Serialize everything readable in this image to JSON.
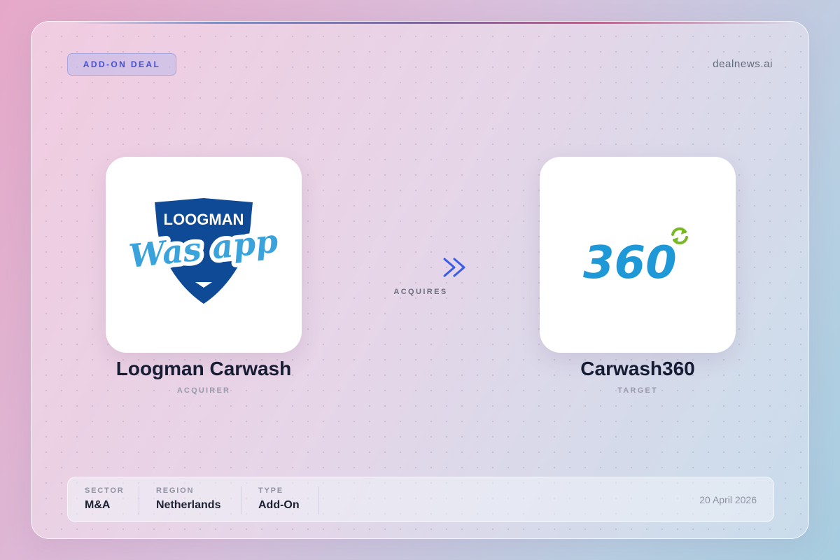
{
  "badge": {
    "label": "ADD-ON DEAL"
  },
  "brand": {
    "name": "dealnews.ai"
  },
  "acquirer": {
    "name": "Loogman Carwash",
    "role": "ACQUIRER",
    "logo_text_top": "LOOGMAN",
    "logo_text_main": "Was app"
  },
  "target": {
    "name": "Carwash360",
    "role": "TARGET",
    "logo_text": "360"
  },
  "deal": {
    "verb": "ACQUIRES"
  },
  "footer": {
    "sector": {
      "label": "SECTOR",
      "value": "M&A"
    },
    "region": {
      "label": "REGION",
      "value": "Netherlands"
    },
    "type": {
      "label": "TYPE",
      "value": "Add-On"
    },
    "date": "20 April 2026"
  },
  "colors": {
    "accent": "#4550d6",
    "arrow": "#3b5bea",
    "loogman_navy": "#0f4a96",
    "loogman_sky": "#3aa3dc",
    "c360_blue": "#1e98d6",
    "c360_green": "#7ab828"
  }
}
